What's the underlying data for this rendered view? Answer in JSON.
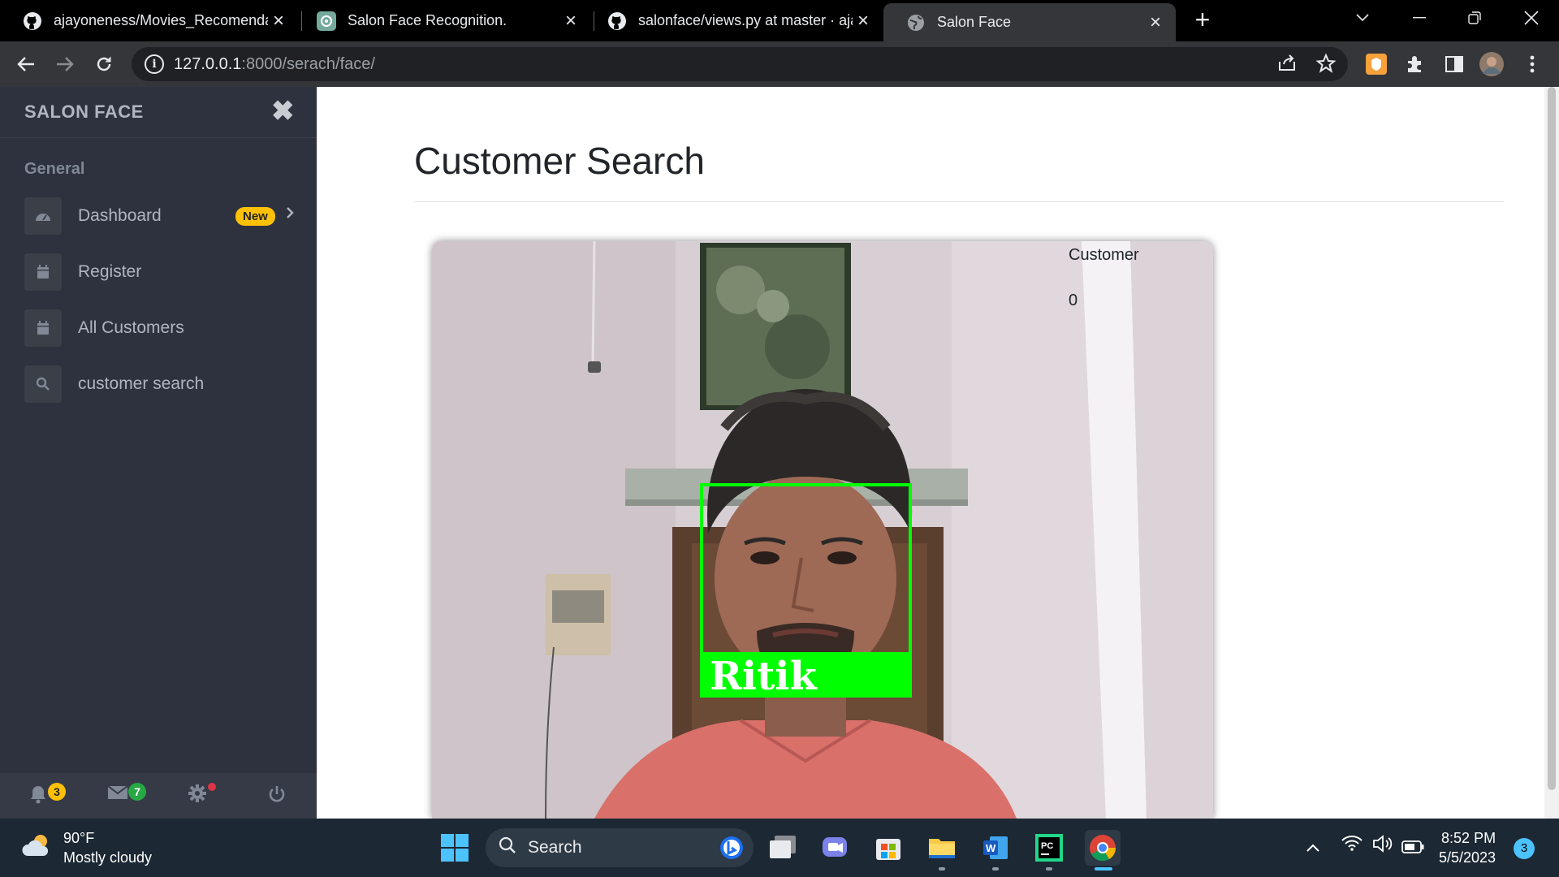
{
  "browser": {
    "tabs": [
      {
        "title": "ajayoneness/Movies_Recomenda",
        "icon": "github-icon",
        "active": false
      },
      {
        "title": "Salon Face Recognition.",
        "icon": "chatgpt-icon",
        "active": false
      },
      {
        "title": "salonface/views.py at master · aja",
        "icon": "github-icon",
        "active": false
      },
      {
        "title": "Salon Face",
        "icon": "globe-icon",
        "active": true
      }
    ],
    "url_host": "127.0.0.1",
    "url_rest": ":8000/serach/face/"
  },
  "sidebar": {
    "brand": "SALON FACE",
    "section_label": "General",
    "items": [
      {
        "label": "Dashboard",
        "icon": "dashboard-icon",
        "badge": "New"
      },
      {
        "label": "Register",
        "icon": "calendar-icon"
      },
      {
        "label": "All Customers",
        "icon": "calendar-icon"
      },
      {
        "label": "customer search",
        "icon": "search-icon"
      }
    ],
    "footer": {
      "notifications_count": "3",
      "messages_count": "7"
    }
  },
  "main": {
    "title": "Customer Search",
    "customer_label": "Customer",
    "customer_count": "0",
    "camera": {
      "detected_name": "Ritik",
      "box_color": "#00ff00"
    }
  },
  "taskbar": {
    "weather_temp": "90°F",
    "weather_desc": "Mostly cloudy",
    "search_placeholder": "Search",
    "time": "8:52 PM",
    "date": "5/5/2023",
    "notification_count": "3"
  },
  "colors": {
    "sidebar_bg": "#2d323e",
    "badge_new": "#ffc107",
    "badge_messages": "#28a745",
    "detection_box": "#00ff00"
  }
}
